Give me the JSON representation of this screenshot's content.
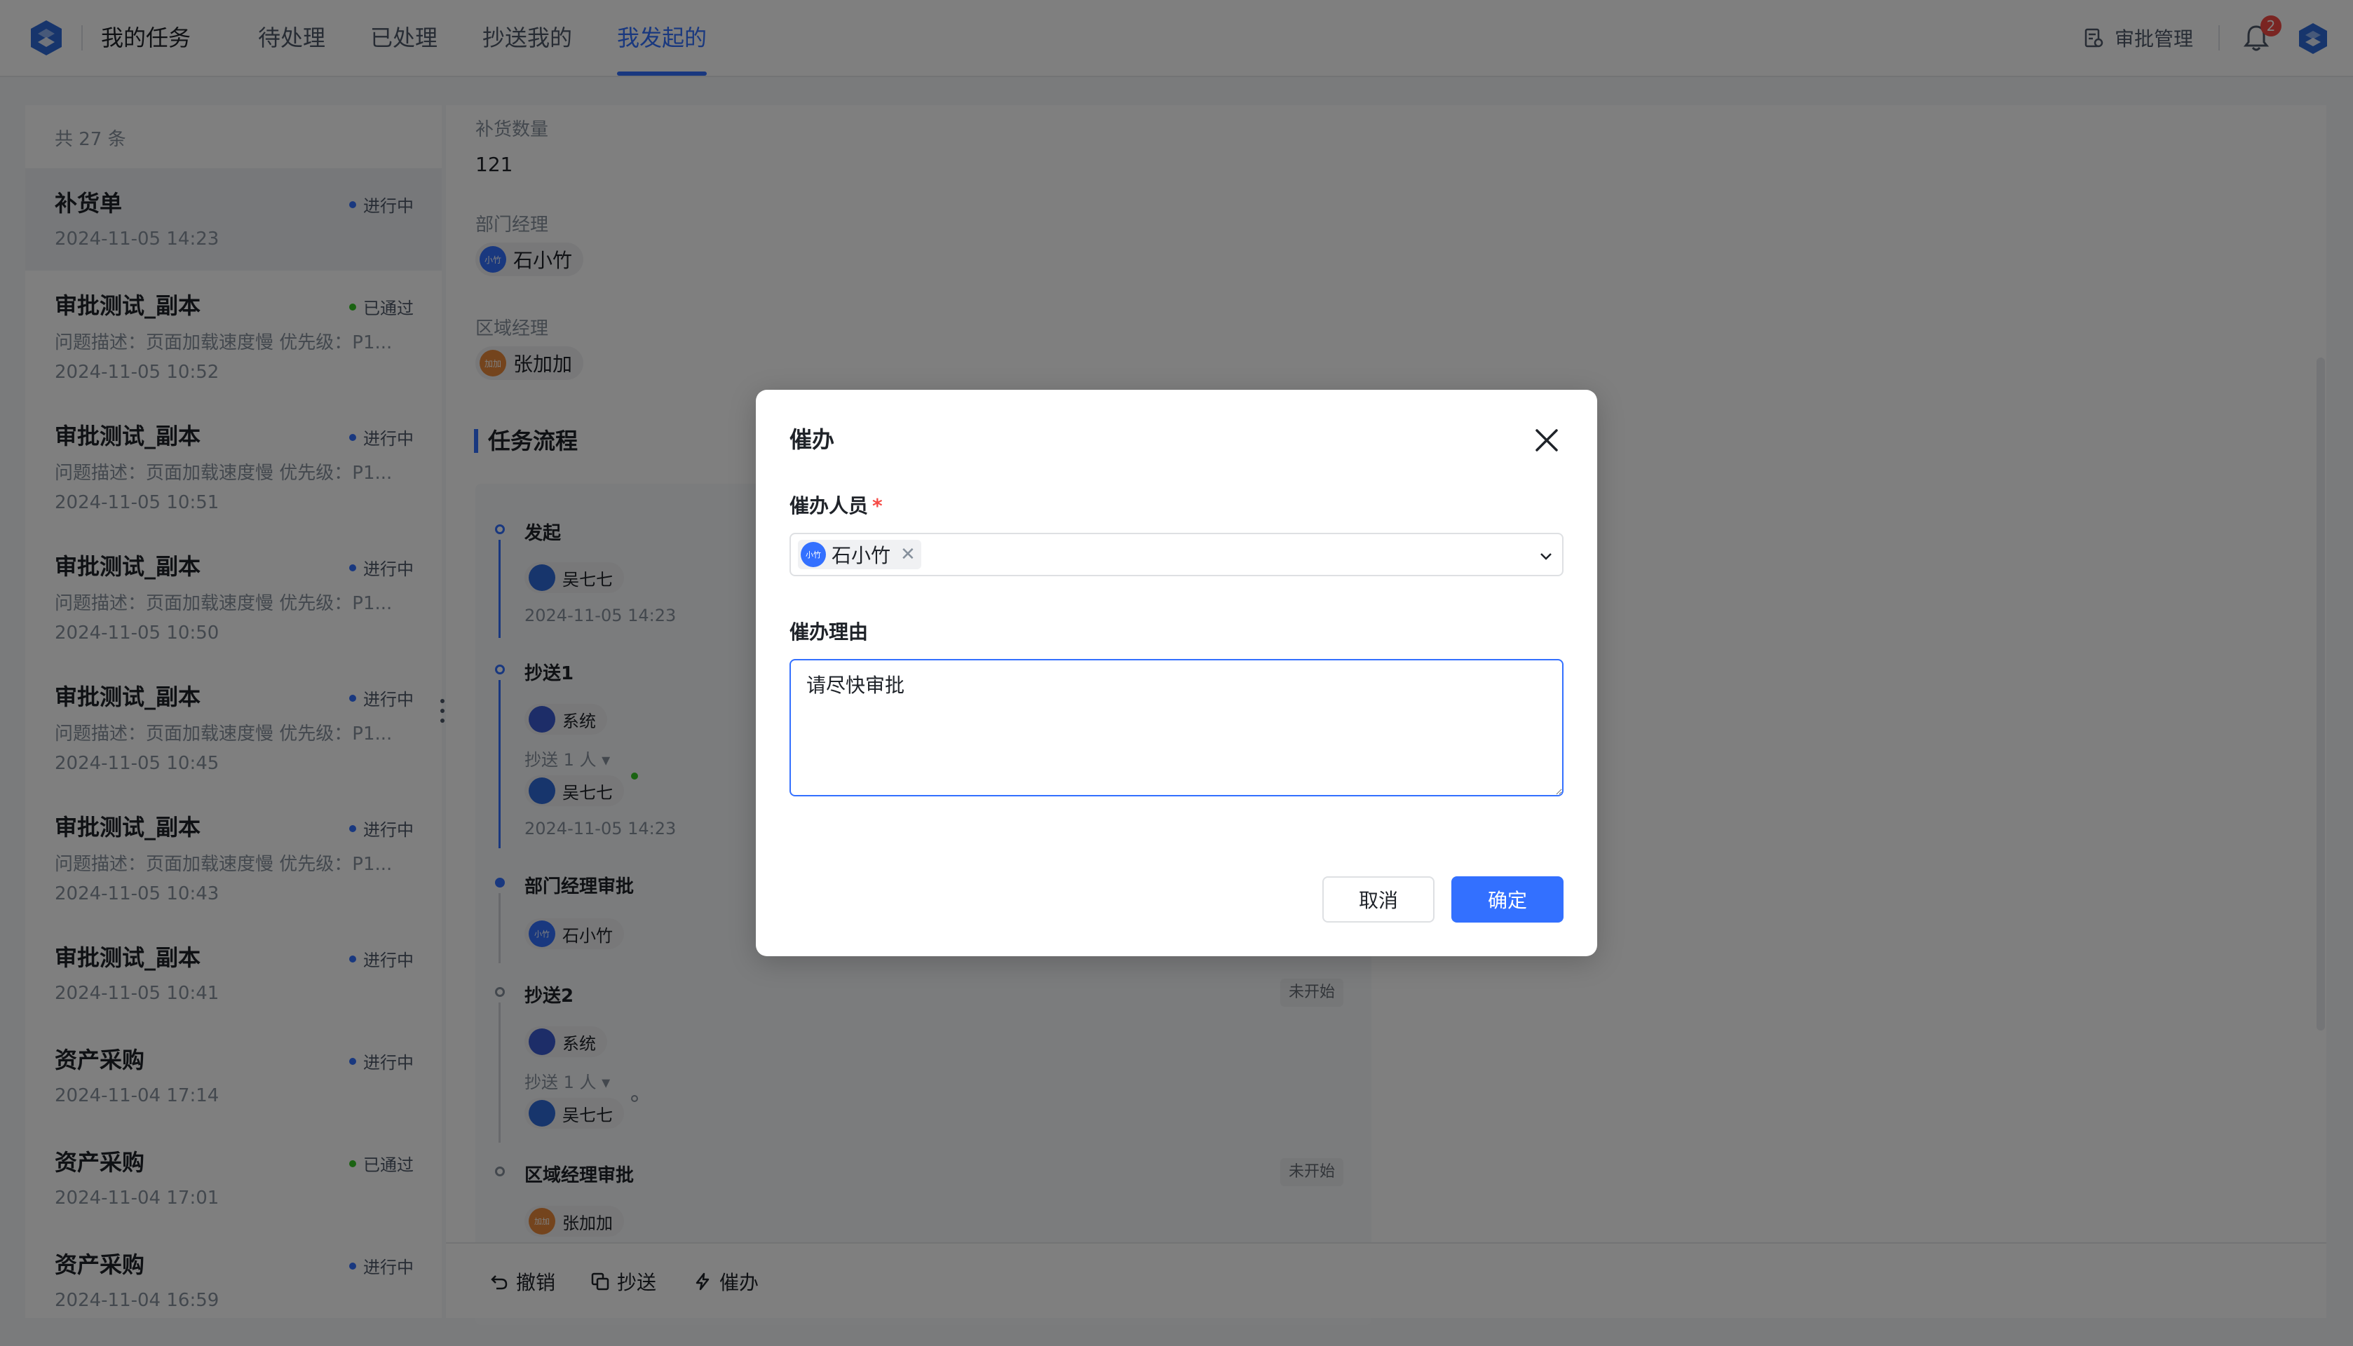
{
  "app": {
    "title": "我的任务"
  },
  "nav": {
    "tabs": [
      {
        "label": "待处理"
      },
      {
        "label": "已处理"
      },
      {
        "label": "抄送我的"
      },
      {
        "label": "我发起的",
        "active": true
      }
    ],
    "admin_label": "审批管理",
    "notification_count": "2"
  },
  "list": {
    "count_text": "共 27 条",
    "items": [
      {
        "title": "补货单",
        "status": "进行中",
        "date": "2024-11-05 14:23",
        "desc": ""
      },
      {
        "title": "审批测试_副本",
        "status": "已通过",
        "desc": "问题描述：页面加载速度慢   优先级：P1...",
        "date": "2024-11-05 10:52"
      },
      {
        "title": "审批测试_副本",
        "status": "进行中",
        "desc": "问题描述：页面加载速度慢   优先级：P1...",
        "date": "2024-11-05 10:51"
      },
      {
        "title": "审批测试_副本",
        "status": "进行中",
        "desc": "问题描述：页面加载速度慢   优先级：P1...",
        "date": "2024-11-05 10:50"
      },
      {
        "title": "审批测试_副本",
        "status": "进行中",
        "desc": "问题描述：页面加载速度慢   优先级：P1...",
        "date": "2024-11-05 10:45"
      },
      {
        "title": "审批测试_副本",
        "status": "进行中",
        "desc": "问题描述：页面加载速度慢   优先级：P1...",
        "date": "2024-11-05 10:43"
      },
      {
        "title": "审批测试_副本",
        "status": "进行中",
        "date": "2024-11-05 10:41",
        "desc": ""
      },
      {
        "title": "资产采购",
        "status": "进行中",
        "date": "2024-11-04 17:14",
        "desc": ""
      },
      {
        "title": "资产采购",
        "status": "已通过",
        "date": "2024-11-04 17:01",
        "desc": ""
      },
      {
        "title": "资产采购",
        "status": "进行中",
        "date": "2024-11-04 16:59",
        "desc": ""
      }
    ]
  },
  "detail": {
    "fields": [
      {
        "label": "补货数量",
        "value": "121"
      },
      {
        "label": "部门经理",
        "person": "石小竹",
        "avatar_text": "小竹"
      },
      {
        "label": "区域经理",
        "person": "张加加",
        "avatar_text": "加加"
      }
    ],
    "section_title": "任务流程",
    "flow": {
      "start": {
        "title": "发起",
        "person": "吴七七",
        "time": "2024-11-05 14:23"
      },
      "cc1": {
        "title": "抄送1",
        "system": "系统",
        "cc_count": "抄送 1 人",
        "person": "吴七七",
        "time": "2024-11-05 14:23"
      },
      "dept": {
        "title": "部门经理审批",
        "person": "石小竹",
        "avatar_text": "小竹"
      },
      "cc2": {
        "title": "抄送2",
        "tag": "未开始",
        "system": "系统",
        "cc_count": "抄送 1 人",
        "person": "吴七七"
      },
      "region": {
        "title": "区域经理审批",
        "tag": "未开始",
        "person": "张加加",
        "avatar_text": "加加"
      }
    },
    "actions": {
      "revoke": "撤销",
      "cc": "抄送",
      "urge": "催办"
    }
  },
  "modal": {
    "title": "催办",
    "person_label": "催办人员",
    "required_mark": "*",
    "selected_person": "石小竹",
    "selected_avatar_text": "小竹",
    "remove_mark": "✕",
    "reason_label": "催办理由",
    "reason_value": "请尽快审批",
    "cancel_label": "取消",
    "ok_label": "确定"
  },
  "colors": {
    "accent": "#3370ff",
    "success": "#34c724",
    "danger": "#f54a45"
  }
}
